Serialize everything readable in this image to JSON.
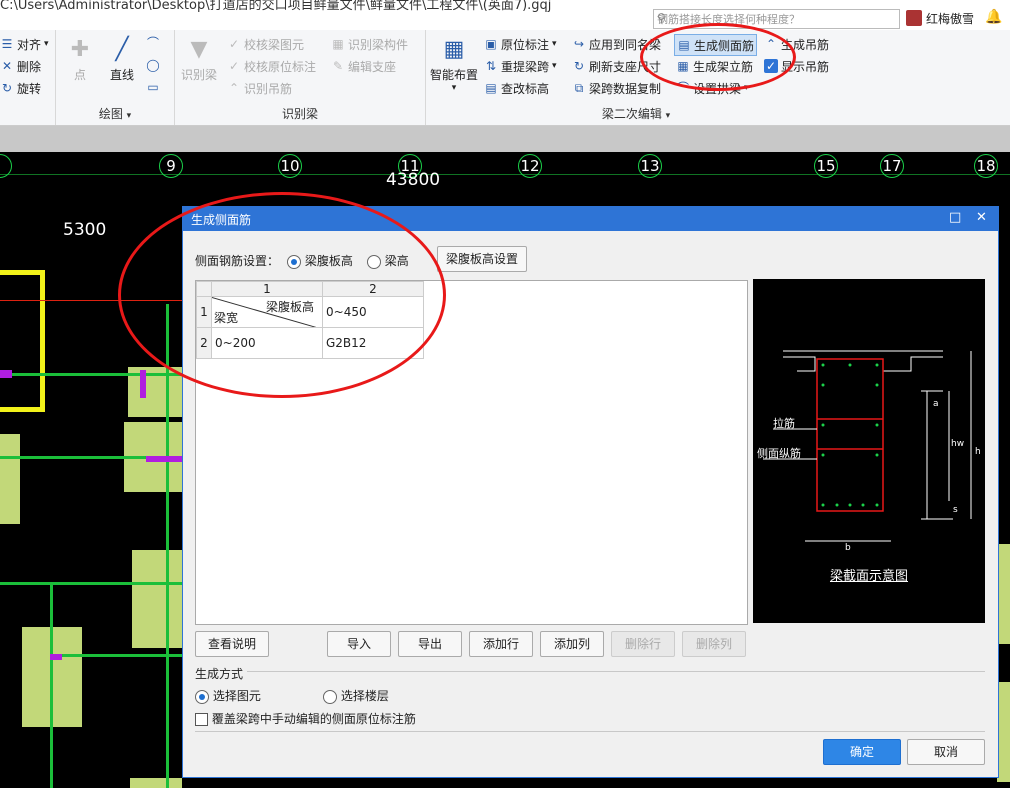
{
  "window": {
    "path": "C:\\Users\\Administrator\\Desktop\\打道店的交口项目鲜量文件\\鲜量文件\\工程文件\\(英面7).gqj",
    "search_placeholder": "钢筋搭接长度选择何种程度？",
    "user": "红梅傲雪"
  },
  "ribbon": {
    "edit": {
      "align": "对齐",
      "delete": "删除",
      "rotate": "旋转"
    },
    "draw": {
      "point": "点",
      "line": "直线",
      "label": "绘图"
    },
    "identify": {
      "identify_beam": "识别梁",
      "check_beam": "校核梁图元",
      "check_position": "校核原位标注",
      "identify_hanger": "识别吊筋",
      "identify_member": "识别梁构件",
      "edit_support": "编辑支座",
      "label": "识别梁"
    },
    "secondary": {
      "smart_layout": "智能布置",
      "position_mark": "原位标注",
      "reextract_span": "重提梁跨",
      "edit_elevation": "查改标高",
      "apply_same": "应用到同名梁",
      "refresh_support": "刷新支座尺寸",
      "copy_span_data": "梁跨数据复制",
      "gen_side_bar": "生成侧面筋",
      "gen_frame_bar": "生成架立筋",
      "setting_arch": "设置拱梁",
      "gen_hanger": "生成吊筋",
      "show_hanger": "显示吊筋",
      "label": "梁二次编辑"
    }
  },
  "cad": {
    "axes": [
      "9",
      "10",
      "11",
      "12",
      "13",
      "15",
      "17",
      "18"
    ],
    "dim_43800": "43800",
    "dim_5300": "5300"
  },
  "dialog": {
    "title": "生成侧面筋",
    "setting_label": "侧面钢筋设置：",
    "opt_web_height": "梁腹板高",
    "opt_beam_height": "梁高",
    "web_height_btn": "梁腹板高设置",
    "grid": {
      "col_headers": [
        "1",
        "2"
      ],
      "row_numbers": [
        "1",
        "2"
      ],
      "diag_top": "梁腹板高",
      "diag_bottom": "梁宽",
      "r1c2": "0~450",
      "r2c1": "0~200",
      "r2c2": "G2B12"
    },
    "preview": {
      "tie_bar": "拉筋",
      "side_bar": "侧面纵筋",
      "caption": "梁截面示意图",
      "dim_a": "a",
      "dim_hw": "hw",
      "dim_h": "h",
      "dim_s": "s",
      "dim_b": "b"
    },
    "buttons": {
      "help": "查看说明",
      "import": "导入",
      "export": "导出",
      "add_row": "添加行",
      "add_col": "添加列",
      "del_row": "删除行",
      "del_col": "删除列",
      "ok": "确定",
      "cancel": "取消"
    },
    "gen_mode": {
      "label": "生成方式",
      "select_element": "选择图元",
      "select_floor": "选择楼层",
      "overwrite": "覆盖梁跨中手动编辑的侧面原位标注筋"
    }
  },
  "colors": {
    "dialog_title": "#2e74d6",
    "annotation": "#e81919",
    "cad_green": "#1bbf3a",
    "cad_pad": "#c2d879"
  }
}
